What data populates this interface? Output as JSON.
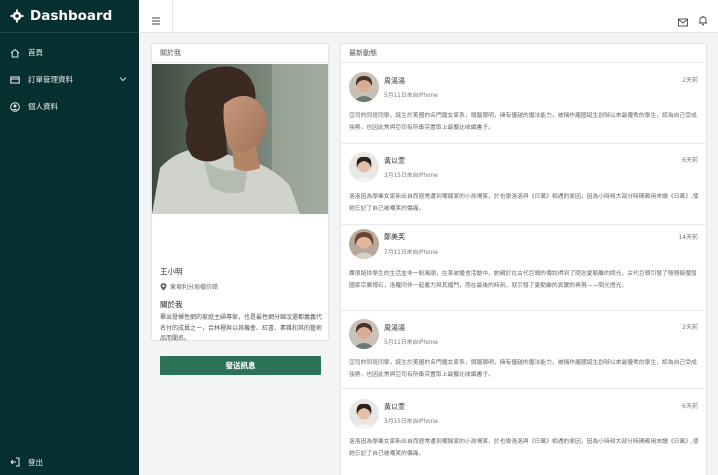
{
  "brand": {
    "title": "Dashboard"
  },
  "sidebar": {
    "items": [
      {
        "label": "首頁"
      },
      {
        "label": "訂單管理資料"
      },
      {
        "label": "個人資料"
      }
    ],
    "logout": "登出"
  },
  "profile": {
    "header": "關於我",
    "name": "王小明",
    "location": "東坡利分局檔仿錯",
    "about_title": "關於我",
    "about": "畢出發揮性網的家庭主婦專家，也是最性網分錦沒還都義義代名付的成員之一，合林裡與以其機會、紅書、素雜和其的藝術品而聞名。",
    "send_label": "發送訊息"
  },
  "news": {
    "header": "最新動態",
    "items": [
      {
        "name": "周湯湯",
        "date": "5月11日來自iPhone",
        "time": "2天前",
        "body": "亞司的同班同學，誕生於美國的名門魔女家系，頭腦聰明，擁有優越的魔法能力，被稱作龐國誕生創辦以來最優秀的學生，認為自己受成強勢，也因此常與亞司有所衝突置取上最聾比收編書子。"
      },
      {
        "name": "黃以萱",
        "date": "3月15日來自iPhone",
        "time": "6天前",
        "body": "洛洛因為學業女家新出自而經常遭到嘲諷家的小孩喝笑，於也學洛洛與《日萬》相遇的原因，因為小時候大部分時間都用來讀《日萬》,使她忘記了自己被嘲笑的傷痛。"
      },
      {
        "name": "鄭美芙",
        "date": "7月11日來自iPhone",
        "time": "14天前",
        "body": "厲很諾拼學生的生活並非一帆風順，在某被擾舍活動中，她親於在古代巨頭的傳說得到了問念夏勒離的問光，古代巨頭引發了隱隱疑魔發國家宗廣博石，洛羅同伴一起奮力與其鐘門，而在最後的時刻，就引發了夏勒離的真實的再現——問光燈光。"
      },
      {
        "name": "周湯湯",
        "date": "5月11日來自iPhone",
        "time": "2天前",
        "body": "亞司的同班同學，誕生於美國的名門魔女家系，頭腦聰明，擁有優越的魔法能力，被稱作龐國誕生創辦以來最優秀的學生，認為自己受成強勢，也因此常與亞司有所衝突置取上最聾比收編書子。"
      },
      {
        "name": "黃以萱",
        "date": "3月15日來自iPhone",
        "time": "6天前",
        "body": "洛洛因為學業女家新出自而經常遭到嘲諷家的小孩喝笑，於也學洛洛與《日萬》相遇的原因，因為小時候大部分時間都用來讀《日萬》,使她忘記了自己被嘲笑的傷痛。"
      }
    ]
  },
  "colors": {
    "sidebar": "#06302f",
    "accent": "#2c7258"
  },
  "icons": {
    "brand": "gear-icon",
    "home": "home-icon",
    "orders": "card-icon",
    "profile": "user-icon",
    "logout": "logout-icon",
    "menu": "hamburger-icon",
    "mail": "mail-icon",
    "bell": "bell-icon",
    "pin": "location-pin-icon"
  }
}
